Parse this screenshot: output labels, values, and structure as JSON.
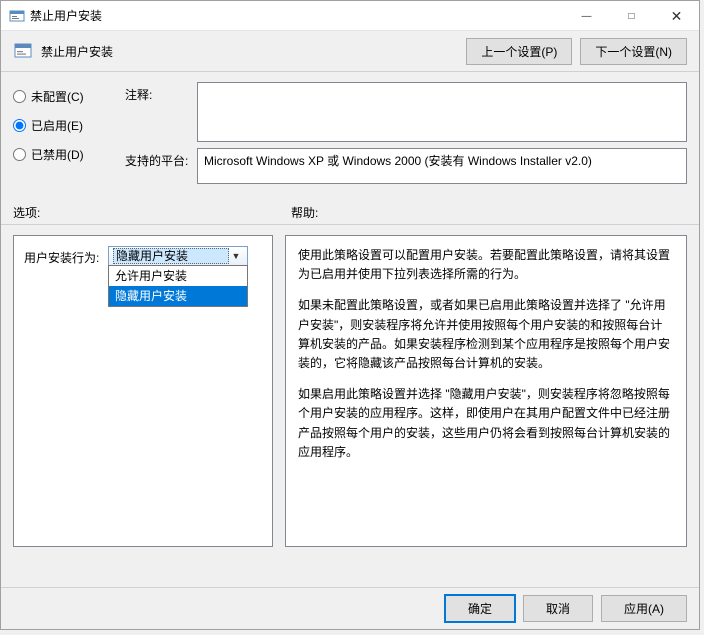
{
  "window": {
    "title": "禁止用户安装",
    "minimize": "—",
    "maximize": "□",
    "close": "✕"
  },
  "header": {
    "title": "禁止用户安装",
    "prev_btn": "上一个设置(P)",
    "next_btn": "下一个设置(N)"
  },
  "radios": {
    "not_configured": "未配置(C)",
    "enabled": "已启用(E)",
    "disabled": "已禁用(D)",
    "selected": "enabled"
  },
  "fields": {
    "comment_label": "注释:",
    "comment_value": "",
    "platform_label": "支持的平台:",
    "platform_value": "Microsoft Windows XP 或 Windows 2000 (安装有 Windows Installer v2.0)"
  },
  "sections": {
    "options_label": "选项:",
    "help_label": "帮助:"
  },
  "options": {
    "behavior_label": "用户安装行为:",
    "selected": "隐藏用户安装",
    "items": [
      "允许用户安装",
      "隐藏用户安装"
    ]
  },
  "help": {
    "p1": "使用此策略设置可以配置用户安装。若要配置此策略设置，请将其设置为已启用并使用下拉列表选择所需的行为。",
    "p2": "如果未配置此策略设置，或者如果已启用此策略设置并选择了 \"允许用户安装\"，则安装程序将允许并使用按照每个用户安装的和按照每台计算机安装的产品。如果安装程序检测到某个应用程序是按照每个用户安装的，它将隐藏该产品按照每台计算机的安装。",
    "p3": "如果启用此策略设置并选择 \"隐藏用户安装\"，则安装程序将忽略按照每个用户安装的应用程序。这样，即使用户在其用户配置文件中已经注册产品按照每个用户的安装，这些用户仍将会看到按照每台计算机安装的应用程序。"
  },
  "footer": {
    "ok": "确定",
    "cancel": "取消",
    "apply": "应用(A)"
  }
}
